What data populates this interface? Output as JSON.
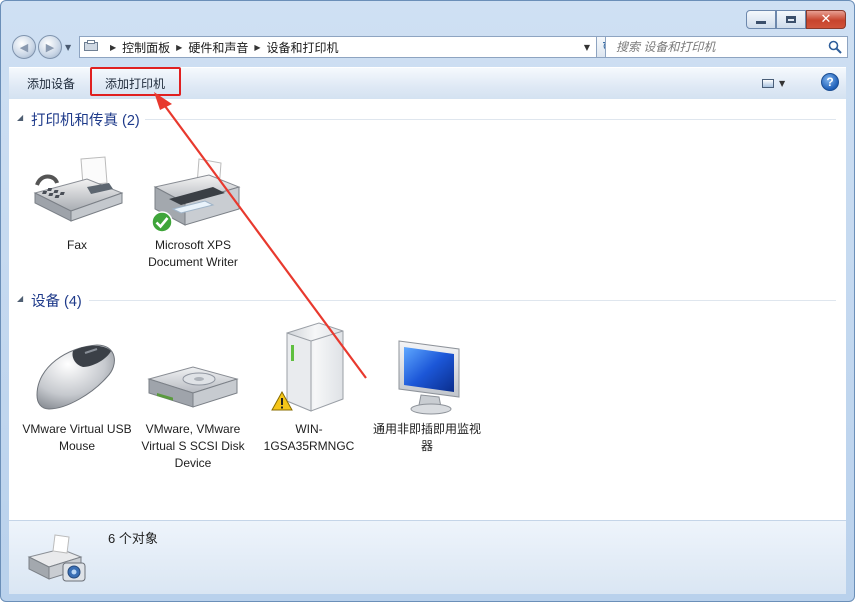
{
  "window": {
    "min_label": "minimize",
    "max_label": "maximize",
    "close_label": "close"
  },
  "address": {
    "crumbs": [
      "控制面板",
      "硬件和声音",
      "设备和打印机"
    ]
  },
  "search": {
    "placeholder": "搜索 设备和打印机"
  },
  "toolbar": {
    "add_device": "添加设备",
    "add_printer": "添加打印机"
  },
  "groups": [
    {
      "title": "打印机和传真 (2)",
      "items": [
        {
          "label": "Fax",
          "icon": "fax-icon"
        },
        {
          "label": "Microsoft XPS Document Writer",
          "icon": "printer-icon",
          "badge": "default-check-icon"
        }
      ]
    },
    {
      "title": "设备 (4)",
      "items": [
        {
          "label": "VMware Virtual USB Mouse",
          "icon": "mouse-icon"
        },
        {
          "label": "VMware, VMware Virtual S SCSI Disk Device",
          "icon": "hard-disk-icon"
        },
        {
          "label": "WIN-1GSA35RMNGC",
          "icon": "computer-tower-icon",
          "badge": "warning-icon"
        },
        {
          "label": "通用非即插即用监视器",
          "icon": "monitor-icon"
        }
      ]
    }
  ],
  "details": {
    "summary": "6 个对象"
  },
  "colors": {
    "highlight": "#e02020",
    "group_title": "#1e3a8a"
  }
}
